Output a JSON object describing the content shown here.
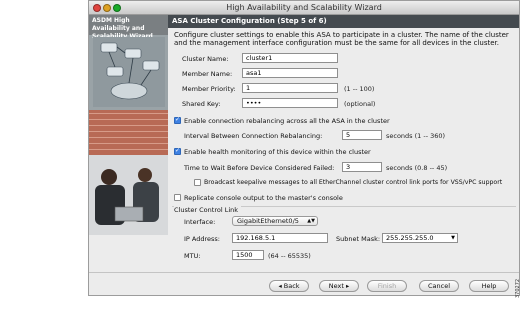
{
  "window": {
    "title": "High Availability and Scalability Wizard"
  },
  "side_panel": {
    "heading": "ASDM High Availability and Scalability Wizard"
  },
  "header": {
    "title": "ASA Cluster Configuration (Step 5 of 6)"
  },
  "description": "Configure cluster settings to enable this ASA to participate in a cluster. The name of the cluster and the management interface configuration must be the same for all devices in the cluster.",
  "fields": {
    "cluster_name": {
      "label": "Cluster Name:",
      "value": "cluster1"
    },
    "member_name": {
      "label": "Member Name:",
      "value": "asa1"
    },
    "member_priority": {
      "label": "Member Priority:",
      "value": "1",
      "hint": "(1 -- 100)"
    },
    "shared_key": {
      "label": "Shared Key:",
      "value": "••••",
      "hint": "(optional)"
    }
  },
  "rebalancing": {
    "checkbox_label": "Enable connection rebalancing across all the ASA in the cluster",
    "checked": true,
    "interval_label": "Interval Between Connection Rebalancing:",
    "interval_value": "5",
    "interval_hint": "seconds (1 -- 360)"
  },
  "health": {
    "checkbox_label": "Enable health monitoring of this device within the cluster",
    "checked": true,
    "time_label": "Time to Wait Before Device Considered Failed:",
    "time_value": "3",
    "time_hint": "seconds (0.8 -- 45)",
    "broadcast_label": "Broadcast keepalive messages to all EtherChannel cluster control link ports for VSS/vPC support",
    "broadcast_checked": false
  },
  "replicate": {
    "label": "Replicate console output to the master's console",
    "checked": false
  },
  "ccl": {
    "section_label": "Cluster Control Link",
    "interface_label": "Interface:",
    "interface_value": "GigabitEthernet0/5",
    "ip_label": "IP Address:",
    "ip_value": "192.168.5.1",
    "mask_label": "Subnet Mask:",
    "mask_value": "255.255.255.0",
    "mtu_label": "MTU:",
    "mtu_value": "1500",
    "mtu_hint": "(64 -- 65535)"
  },
  "buttons": {
    "back": "◂ Back",
    "next": "Next ▸",
    "finish": "Finish",
    "cancel": "Cancel",
    "help": "Help"
  },
  "figure_number": "370272"
}
